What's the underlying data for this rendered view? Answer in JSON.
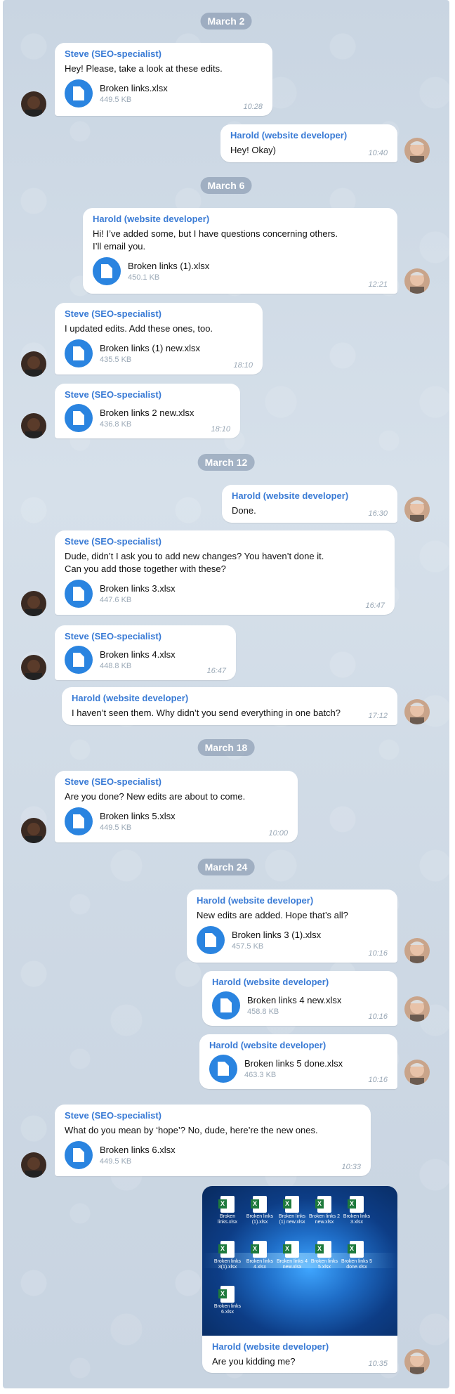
{
  "dates": [
    "March 2",
    "March 6",
    "March 12",
    "March 18",
    "March 24"
  ],
  "colors": {
    "sender": "#3a7bd5",
    "file_icon": "#2a84e0",
    "date_pill": "#7a8ca5"
  },
  "messages": [
    {
      "sender": "Steve (SEO-specialist)",
      "text": "Hey! Please, take a look at these edits.",
      "file": {
        "name": "Broken links.xlsx",
        "size": "449.5 KB"
      },
      "time": "10:28"
    },
    {
      "sender": "Harold (website developer)",
      "text": "Hey! Okay)",
      "time": "10:40"
    },
    {
      "sender": "Harold (website developer)",
      "text": "Hi! I’ve added some, but I have questions concerning others.\nI’ll email you.",
      "file": {
        "name": "Broken links (1).xlsx",
        "size": "450.1 KB"
      },
      "time": "12:21"
    },
    {
      "sender": "Steve (SEO-specialist)",
      "text": "I updated edits. Add these ones, too.",
      "file": {
        "name": "Broken links (1) new.xlsx",
        "size": "435.5 KB"
      },
      "time": "18:10"
    },
    {
      "sender": "Steve (SEO-specialist)",
      "file": {
        "name": "Broken links 2 new.xlsx",
        "size": "436.8 KB"
      },
      "time": "18:10"
    },
    {
      "sender": "Harold (website developer)",
      "text": "Done.",
      "time": "16:30"
    },
    {
      "sender": "Steve (SEO-specialist)",
      "text": "Dude, didn’t I ask you to add new changes? You haven’t done it.\nCan you add those together with these?",
      "file": {
        "name": "Broken links 3.xlsx",
        "size": "447.6 KB"
      },
      "time": "16:47"
    },
    {
      "sender": "Steve (SEO-specialist)",
      "file": {
        "name": "Broken links 4.xlsx",
        "size": "448.8 KB"
      },
      "time": "16:47"
    },
    {
      "sender": "Harold (website developer)",
      "text": "I haven’t seen them. Why didn’t you send everything in one batch?",
      "time": "17:12"
    },
    {
      "sender": "Steve (SEO-specialist)",
      "text": "Are you done? New edits are about to come.",
      "file": {
        "name": "Broken links 5.xlsx",
        "size": "449.5 KB"
      },
      "time": "10:00"
    },
    {
      "sender": "Harold (website developer)",
      "text": "New edits are added. Hope that’s all?",
      "file": {
        "name": "Broken links 3 (1).xlsx",
        "size": "457.5 KB"
      },
      "time": "10:16"
    },
    {
      "sender": "Harold (website developer)",
      "file": {
        "name": "Broken links 4 new.xlsx",
        "size": "458.8 KB"
      },
      "time": "10:16"
    },
    {
      "sender": "Harold (website developer)",
      "file": {
        "name": "Broken links 5 done.xlsx",
        "size": "463.3 KB"
      },
      "time": "10:16"
    },
    {
      "sender": "Steve (SEO-specialist)",
      "text": "What do you mean by ‘hope’? No, dude, here’re the new ones.",
      "file": {
        "name": "Broken links 6.xlsx",
        "size": "449.5 KB"
      },
      "time": "10:33"
    },
    {
      "sender": "Harold (website developer)",
      "text": "Are you kidding me?",
      "time": "10:35"
    }
  ],
  "desktop_files": [
    "Broken links.xlsx",
    "Broken links (1).xlsx",
    "Broken links (1) new.xlsx",
    "Broken links 2 new.xlsx",
    "Broken links 3.xlsx",
    "Broken links 3(1).xlsx",
    "Broken links 4.xlsx",
    "Broken links 4 new.xlsx",
    "Broken links 5.xlsx",
    "Broken links 5 done.xlsx",
    "Broken links 6.xlsx"
  ]
}
